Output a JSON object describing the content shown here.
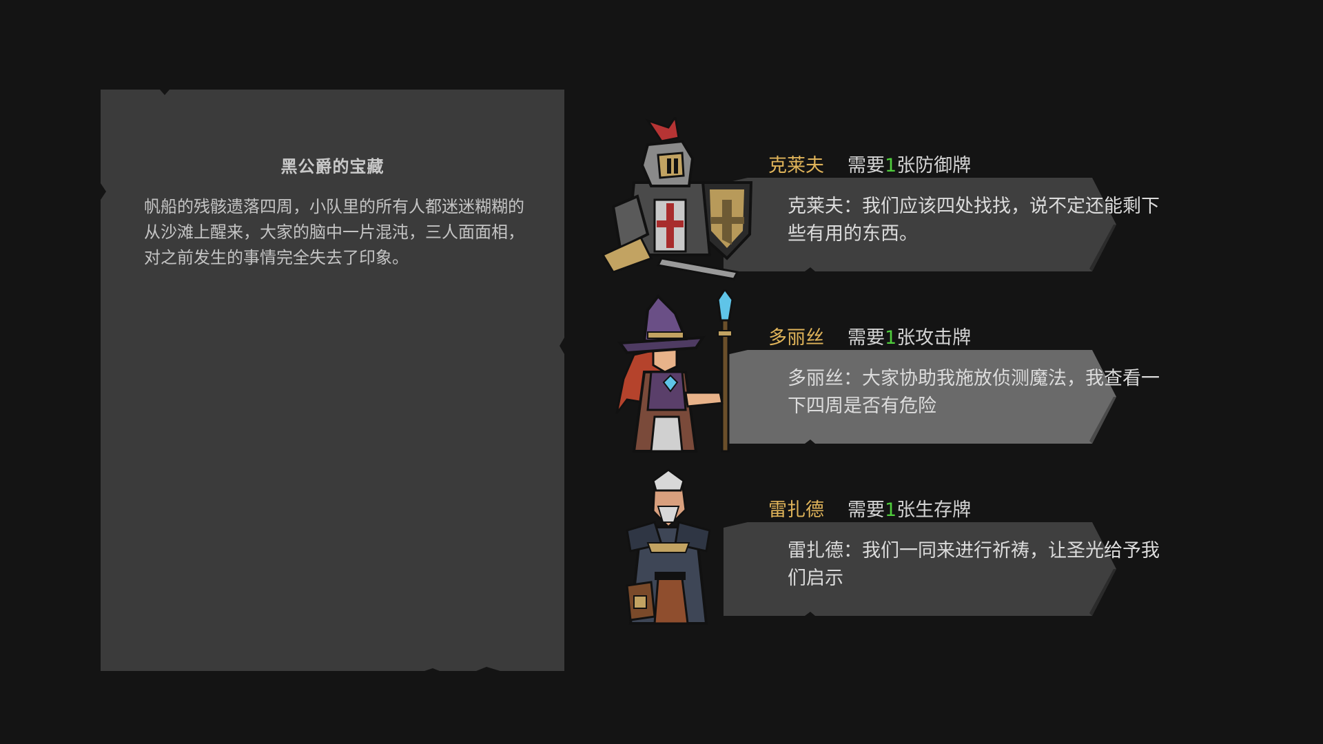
{
  "story": {
    "title": "黑公爵的宝藏",
    "body": "帆船的残骸遗落四周，小队里的所有人都迷迷糊糊的从沙滩上醒来，大家的脑中一片混沌，三人面面相，对之前发生的事情完全失去了印象。"
  },
  "characters": [
    {
      "name": "克莱夫",
      "req_prefix": "需要",
      "req_count": "1",
      "req_suffix": "张防御牌",
      "dialogue": "克莱夫：我们应该四处找找，说不定还能剩下些有用的东西。",
      "portrait_icon": "knight-portrait"
    },
    {
      "name": "多丽丝",
      "req_prefix": "需要",
      "req_count": "1",
      "req_suffix": "张攻击牌",
      "dialogue": "多丽丝：大家协助我施放侦测魔法，我查看一下四周是否有危险",
      "portrait_icon": "witch-portrait"
    },
    {
      "name": "雷扎德",
      "req_prefix": "需要",
      "req_count": "1",
      "req_suffix": "张生存牌",
      "dialogue": "雷扎德：我们一同来进行祈祷，让圣光给予我们启示",
      "portrait_icon": "priest-portrait"
    }
  ],
  "colors": {
    "background": "#141414",
    "panel": "#3b3b3b",
    "name": "#e0b45a",
    "count": "#4fce3c",
    "speech_bubble_1": "#3f3f3f",
    "speech_bubble_2": "#6a6a6a",
    "speech_bubble_3": "#3f3f3f"
  }
}
